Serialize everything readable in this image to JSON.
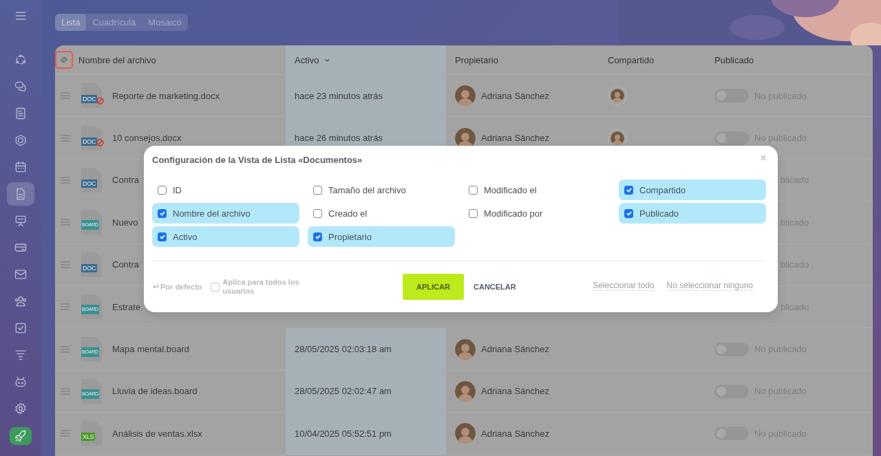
{
  "sidebar": {
    "items": [
      {
        "kind": "menu",
        "selected": false
      },
      {
        "kind": "nav",
        "selected": false
      },
      {
        "kind": "nav",
        "selected": false
      },
      {
        "kind": "nav",
        "selected": false
      },
      {
        "kind": "nav",
        "selected": false
      },
      {
        "kind": "nav",
        "selected": false
      },
      {
        "kind": "nav",
        "selected": true
      },
      {
        "kind": "nav",
        "selected": false
      },
      {
        "kind": "nav",
        "selected": false
      },
      {
        "kind": "nav",
        "selected": false
      },
      {
        "kind": "nav",
        "selected": false
      },
      {
        "kind": "nav",
        "selected": false
      },
      {
        "kind": "nav",
        "selected": false
      },
      {
        "kind": "nav",
        "selected": false
      },
      {
        "kind": "nav",
        "selected": false
      },
      {
        "kind": "accent",
        "selected": false
      }
    ]
  },
  "view_tabs": [
    {
      "label": "Lista",
      "selected": true
    },
    {
      "label": "Cuadrícula",
      "selected": false
    },
    {
      "label": "Mosaico",
      "selected": false
    }
  ],
  "table": {
    "columns": [
      {
        "label": "Nombre del archivo",
        "sorted": false
      },
      {
        "label": "Activo",
        "sorted": true
      },
      {
        "label": "Propietario",
        "sorted": false
      },
      {
        "label": "Compartido",
        "sorted": false
      },
      {
        "label": "Publicado",
        "sorted": false
      }
    ],
    "rows": [
      {
        "kind": "doc",
        "badge": "DOC",
        "restricted": true,
        "name": "Reporte de marketing.docx",
        "activity": "hace 23 minutos atrás",
        "owner": "Adriana Sánchez",
        "shared": true,
        "published": false,
        "publish_text": "No publicado"
      },
      {
        "kind": "doc",
        "badge": "DOC",
        "restricted": true,
        "name": "10 consejos.docx",
        "activity": "hace 26 minutos atrás",
        "owner": "Adriana Sánchez",
        "shared": true,
        "published": false,
        "publish_text": "No publicado"
      },
      {
        "kind": "doc",
        "badge": "DOC",
        "restricted": false,
        "name": "Contra",
        "shared": false,
        "publish_text": "blicado"
      },
      {
        "kind": "board",
        "badge": "BOARD",
        "restricted": false,
        "name": "Nuevo",
        "shared": false,
        "publish_text": "blicado"
      },
      {
        "kind": "doc",
        "badge": "DOC",
        "restricted": false,
        "name": "Contra",
        "shared": false,
        "publish_text": "blicado"
      },
      {
        "kind": "board",
        "badge": "BOARD",
        "restricted": false,
        "name": "Estrate",
        "shared": false,
        "publish_text": "blicado"
      },
      {
        "kind": "board",
        "badge": "BOARD",
        "restricted": false,
        "name": "Mapa mental.board",
        "activity": "28/05/2025 02:03:18 am",
        "owner": "Adriana Sánchez",
        "shared": false,
        "published": false,
        "publish_text": "No publicado"
      },
      {
        "kind": "board",
        "badge": "BOARD",
        "restricted": false,
        "name": "Lluvia de ideas.board",
        "activity": "28/05/2025 02:02:47 am",
        "owner": "Adriana Sánchez",
        "shared": false,
        "published": false,
        "publish_text": "No publicado"
      },
      {
        "kind": "xls",
        "badge": "XLS",
        "restricted": false,
        "name": "Análisis de ventas.xlsx",
        "activity": "10/04/2025 05:52:51 pm",
        "owner": "Adriana Sánchez",
        "shared": false,
        "published": false,
        "publish_text": "No publicado"
      }
    ]
  },
  "dialog": {
    "title": "Configuración de la Vista de Lista «Documentos»",
    "close": "×",
    "option_columns": [
      [
        {
          "label": "ID",
          "checked": false
        },
        {
          "label": "Nombre del archivo",
          "checked": true
        },
        {
          "label": "Activo",
          "checked": true
        }
      ],
      [
        {
          "label": "Tamaño del archivo",
          "checked": false
        },
        {
          "label": "Creado el",
          "checked": false
        },
        {
          "label": "Propietario",
          "checked": true
        }
      ],
      [
        {
          "label": "Modificado el",
          "checked": false
        },
        {
          "label": "Modificado por",
          "checked": false
        }
      ],
      [
        {
          "label": "Compartido",
          "checked": true
        },
        {
          "label": "Publicado",
          "checked": true
        }
      ]
    ],
    "reset": "Por defecto",
    "apply_all": {
      "label": "Aplica para todos los usuarios",
      "checked": false
    },
    "apply": "APLICAR",
    "cancel": "CANCELAR",
    "select_all": "Seleccionar todo",
    "select_none": "No seleccionar ninguno"
  }
}
